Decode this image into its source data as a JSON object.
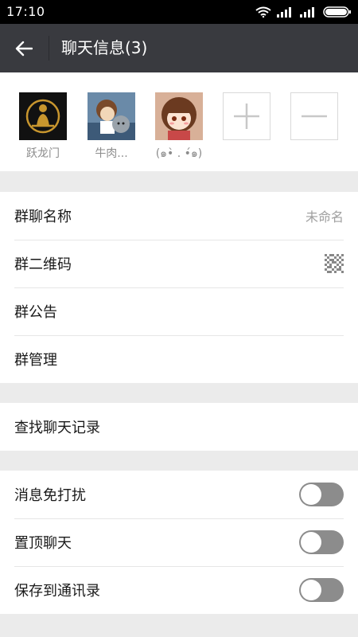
{
  "status_bar": {
    "time": "17:10"
  },
  "header": {
    "title": "聊天信息(3)"
  },
  "members": [
    {
      "name": "跃龙门"
    },
    {
      "name": "牛肉..."
    },
    {
      "name": "(๑•̀ . •́๑)"
    }
  ],
  "settings_group_1": {
    "group_name_label": "群聊名称",
    "group_name_value": "未命名",
    "qrcode_label": "群二维码",
    "announcement_label": "群公告",
    "management_label": "群管理"
  },
  "settings_group_2": {
    "search_history_label": "查找聊天记录"
  },
  "settings_group_3": {
    "mute_label": "消息免打扰",
    "mute_on": false,
    "pin_label": "置顶聊天",
    "pin_on": false,
    "save_contacts_label": "保存到通讯录",
    "save_contacts_on": false
  },
  "colors": {
    "appbar": "#393a3f",
    "toggle_off": "#8c8c8c",
    "background": "#ebebeb"
  }
}
